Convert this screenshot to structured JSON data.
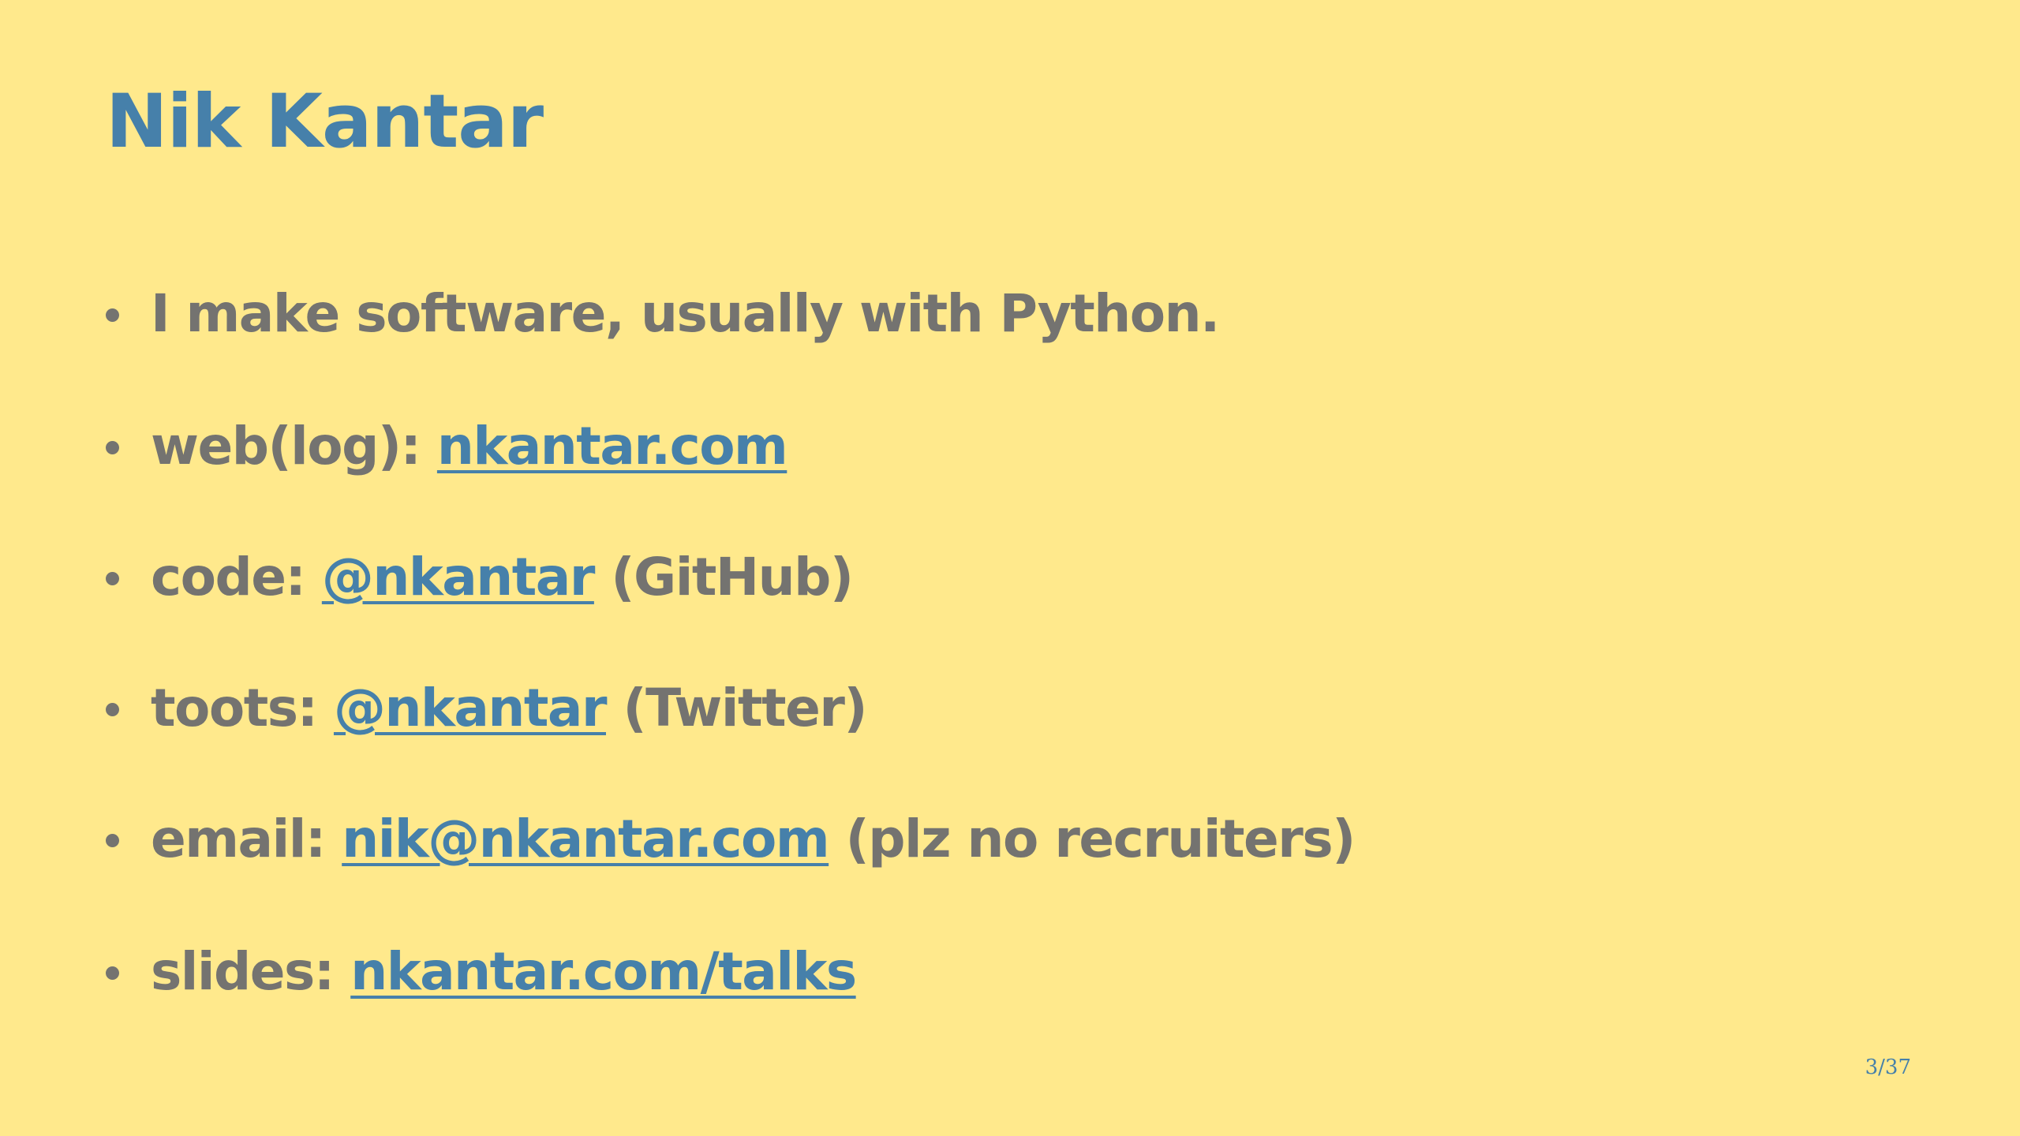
{
  "slide": {
    "title": "Nik Kantar",
    "bullets": [
      {
        "text": "I make software, usually with Python."
      },
      {
        "prefix": "web(log): ",
        "link": "nkantar.com",
        "suffix": ""
      },
      {
        "prefix": "code: ",
        "link": "@nkantar",
        "suffix": " (GitHub)"
      },
      {
        "prefix": "toots: ",
        "link": "@nkantar",
        "suffix": " (Twitter)"
      },
      {
        "prefix": "email: ",
        "link": "nik@nkantar.com",
        "suffix": " (plz no recruiters)"
      },
      {
        "prefix": "slides: ",
        "link": "nkantar.com/talks",
        "suffix": ""
      }
    ],
    "page_number": "3/37"
  },
  "colors": {
    "background": "#ffe98c",
    "title": "#4680aa",
    "body_text": "#747370",
    "link": "#4680aa"
  }
}
